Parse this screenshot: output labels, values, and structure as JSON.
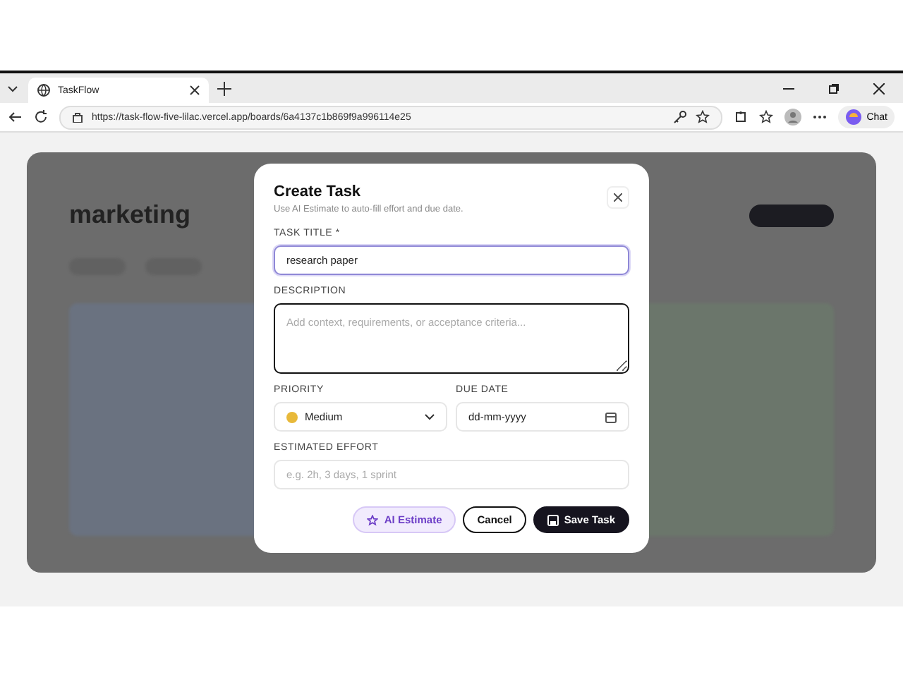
{
  "browser": {
    "tab_title": "TaskFlow",
    "url": "https://task-flow-five-lilac.vercel.app/boards/6a4137c1b869f9a996114e25",
    "chat_label": "Chat"
  },
  "board": {
    "title": "marketing"
  },
  "dialog": {
    "title": "Create Task",
    "subtitle": "Use AI Estimate to auto-fill effort and due date.",
    "fields": [
      {
        "kind": "text",
        "label": "TASK TITLE *",
        "value": "research paper",
        "focused": true
      },
      {
        "kind": "textarea",
        "label": "DESCRIPTION",
        "placeholder": "Add context, requirements, or acceptance criteria...",
        "focused": false
      },
      {
        "kind": "select",
        "label": "PRIORITY",
        "value": "Medium",
        "color": "#e8b93a"
      },
      {
        "kind": "date",
        "label": "DUE DATE",
        "value": "dd-mm-yyyy"
      },
      {
        "kind": "text",
        "label": "ESTIMATED EFFORT",
        "placeholder": "e.g. 2h, 3 days, 1 sprint",
        "focused": false
      }
    ],
    "buttons": [
      {
        "kind": "ai",
        "label": "AI Estimate"
      },
      {
        "kind": "secondary",
        "label": "Cancel"
      },
      {
        "kind": "primary",
        "label": "Save Task"
      }
    ]
  }
}
